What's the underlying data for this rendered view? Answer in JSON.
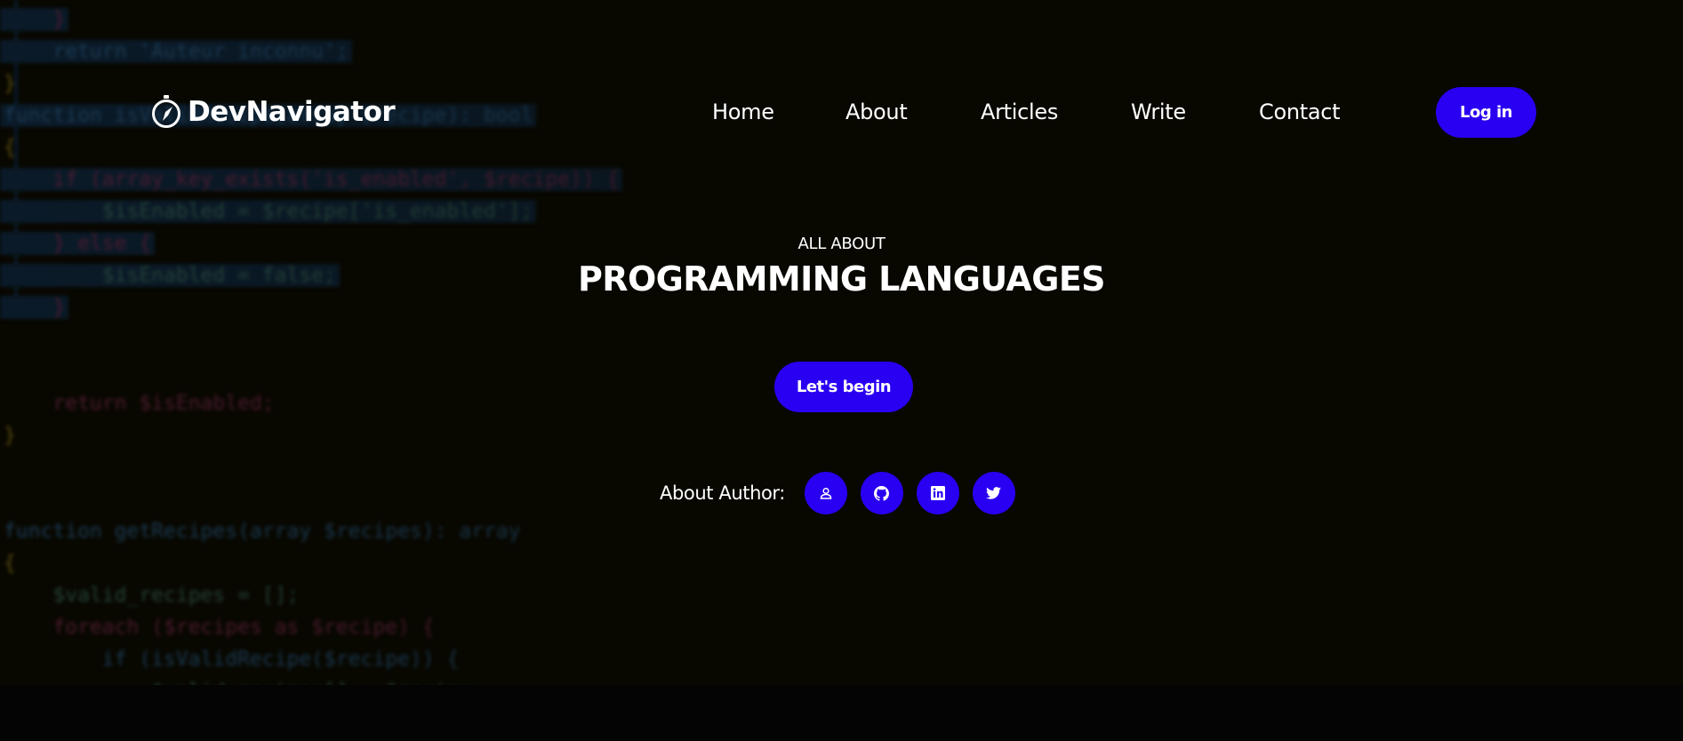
{
  "brand": {
    "name": "DevNavigator",
    "icon": "compass-icon"
  },
  "nav": {
    "links": [
      {
        "label": "Home"
      },
      {
        "label": "About"
      },
      {
        "label": "Articles"
      },
      {
        "label": "Write"
      },
      {
        "label": "Contact"
      }
    ],
    "login_label": "Log in"
  },
  "hero": {
    "eyebrow": "ALL ABOUT",
    "headline": "PROGRAMMING LANGUAGES",
    "cta_label": "Let's begin",
    "author_label": "About Author:",
    "socials": [
      {
        "name": "profile",
        "icon": "user-icon"
      },
      {
        "name": "github",
        "icon": "github-icon"
      },
      {
        "name": "linkedin",
        "icon": "linkedin-icon"
      },
      {
        "name": "twitter",
        "icon": "twitter-icon"
      }
    ]
  },
  "background_code": [
    "    }",
    "    return 'Auteur inconnu';",
    "}",
    "function isValidRecipe(array $recipe): bool",
    "{",
    "    if (array_key_exists('is_enabled', $recipe)) {",
    "        $isEnabled = $recipe['is_enabled'];",
    "    } else {",
    "        $isEnabled = false;",
    "    }",
    "",
    "",
    "    return $isEnabled;",
    "}",
    "",
    "",
    "function getRecipes(array $recipes): array",
    "{",
    "    $valid_recipes = [];",
    "    foreach ($recipes as $recipe) {",
    "        if (isValidRecipe($recipe)) {",
    "            $valid_recipes[] = $recipe;"
  ],
  "colors": {
    "accent": "#2a00f2",
    "background": "#080700",
    "text": "#ffffff"
  }
}
